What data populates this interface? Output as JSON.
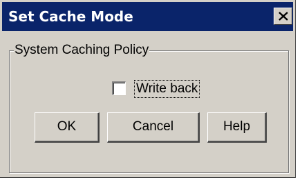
{
  "dialog": {
    "title": "Set Cache Mode",
    "close_icon": "close-x-icon"
  },
  "group": {
    "label": "System Caching Policy"
  },
  "checkbox": {
    "label": "Write back",
    "checked": false
  },
  "buttons": {
    "ok": "OK",
    "cancel": "Cancel",
    "help": "Help"
  },
  "colors": {
    "title_bar": "#0a246a",
    "face": "#d4d0c8"
  }
}
